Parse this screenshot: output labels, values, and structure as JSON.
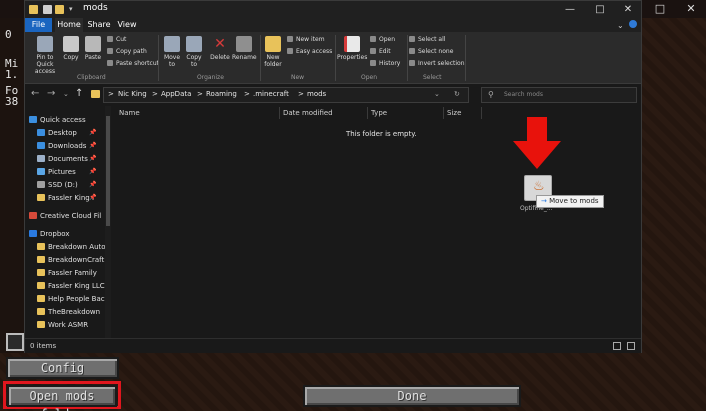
{
  "minecraft": {
    "left_text": [
      "0",
      "Mi",
      "1.",
      "Fo",
      "38"
    ],
    "buttons": {
      "config_label": "Config",
      "open_mods_label": "Open mods folder",
      "done_label": "Done"
    },
    "highlight_color": "#e0161e"
  },
  "explorer": {
    "title": "mods",
    "window_controls": [
      "minimize-icon",
      "maximize-icon",
      "close-icon"
    ],
    "tabs": [
      {
        "label": "File"
      },
      {
        "label": "Home"
      },
      {
        "label": "Share"
      },
      {
        "label": "View"
      }
    ],
    "ribbon": {
      "clipboard": {
        "pin_label": "Pin to Quick access",
        "copy_label": "Copy",
        "paste_label": "Paste",
        "cut_label": "Cut",
        "copy_path_label": "Copy path",
        "paste_shortcut_label": "Paste shortcut",
        "group_label": "Clipboard"
      },
      "organize": {
        "move_to_label": "Move to",
        "copy_to_label": "Copy to",
        "delete_label": "Delete",
        "rename_label": "Rename",
        "group_label": "Organize"
      },
      "new": {
        "new_folder_label": "New folder",
        "new_item_label": "New item",
        "easy_access_label": "Easy access",
        "group_label": "New"
      },
      "open": {
        "properties_label": "Properties",
        "open_label": "Open",
        "edit_label": "Edit",
        "history_label": "History",
        "group_label": "Open"
      },
      "select": {
        "select_all_label": "Select all",
        "select_none_label": "Select none",
        "invert_label": "Invert selection",
        "group_label": "Select"
      }
    },
    "address": {
      "crumbs": [
        "Nic King",
        "AppData",
        "Roaming",
        ".minecraft",
        "mods"
      ],
      "separator": ">",
      "search_placeholder": "Search mods"
    },
    "nav_pane": {
      "quick_access_label": "Quick access",
      "items": [
        {
          "label": "Desktop",
          "pinned": true,
          "icon": "desktop-icon"
        },
        {
          "label": "Downloads",
          "pinned": true,
          "icon": "downloads-icon"
        },
        {
          "label": "Documents",
          "pinned": true,
          "icon": "documents-icon"
        },
        {
          "label": "Pictures",
          "pinned": true,
          "icon": "pictures-icon"
        },
        {
          "label": "SSD (D:)",
          "pinned": true,
          "icon": "drive-icon"
        },
        {
          "label": "Fassler King I",
          "pinned": true,
          "icon": "folder-icon"
        },
        {
          "label": "Creative Cloud Fil",
          "pinned": false,
          "icon": "creative-cloud-icon"
        },
        {
          "label": "Dropbox",
          "pinned": false,
          "icon": "dropbox-icon"
        },
        {
          "label": "Breakdown Auto",
          "pinned": false,
          "icon": "folder-icon"
        },
        {
          "label": "BreakdownCraft",
          "pinned": false,
          "icon": "folder-icon"
        },
        {
          "label": "Fassler Family",
          "pinned": false,
          "icon": "folder-icon"
        },
        {
          "label": "Fassler King LLC",
          "pinned": false,
          "icon": "folder-icon"
        },
        {
          "label": "Help People Bac",
          "pinned": false,
          "icon": "folder-icon"
        },
        {
          "label": "TheBreakdown",
          "pinned": false,
          "icon": "folder-icon"
        },
        {
          "label": "Work ASMR",
          "pinned": false,
          "icon": "folder-icon"
        }
      ]
    },
    "columns": [
      "Name",
      "Date modified",
      "Type",
      "Size"
    ],
    "empty_message": "This folder is empty.",
    "status_text": "0 items"
  },
  "drag": {
    "file_name": "Optifine_...",
    "tooltip": "Move to mods",
    "arrow_color": "#e8120c"
  }
}
